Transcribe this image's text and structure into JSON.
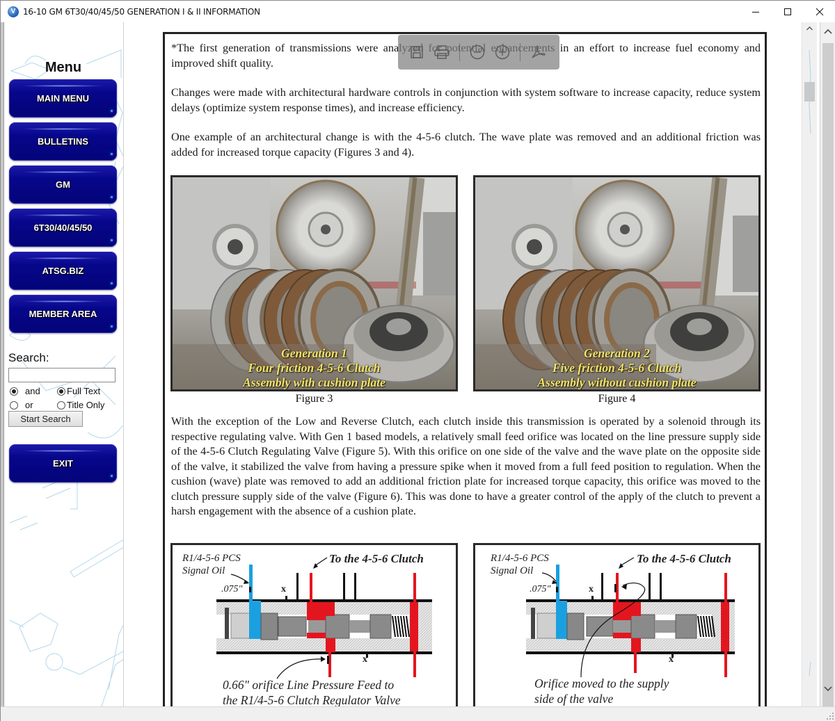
{
  "window": {
    "title": "16-10 GM 6T30/40/45/50 GENERATION I & II INFORMATION",
    "app_icon_letter": "V",
    "controls": [
      "minimize",
      "maximize",
      "close"
    ]
  },
  "sidebar": {
    "menu_title": "Menu",
    "nav_buttons": [
      {
        "label": "MAIN MENU"
      },
      {
        "label": "BULLETINS"
      },
      {
        "label": "GM"
      },
      {
        "label": "6T30/40/45/50"
      },
      {
        "label": "ATSG.BIZ"
      },
      {
        "label": "MEMBER AREA"
      }
    ],
    "search": {
      "label": "Search:",
      "value": "",
      "placeholder": "",
      "options_logic": [
        {
          "label": "and",
          "selected": true
        },
        {
          "label": "or",
          "selected": false
        }
      ],
      "options_scope": [
        {
          "label": "Full Text",
          "selected": true
        },
        {
          "label": "Title Only",
          "selected": false
        }
      ],
      "button_label": "Start Search"
    },
    "exit_label": "EXIT"
  },
  "pdf_toolbar": {
    "icons": [
      "save-icon",
      "print-icon",
      "zoom-out-icon",
      "zoom-in-icon",
      "acrobat-icon"
    ]
  },
  "document": {
    "paragraphs": [
      "*The first generation of transmissions were analyzed for potential enhancements in an effort to increase fuel economy and improved shift quality.",
      "Changes were made with architectural hardware controls in conjunction with system software to increase capacity, reduce system delays (optimize system response times), and increase efficiency.",
      "One example of an architectural change is with the 4-5-6 clutch. The wave plate was removed and an additional friction was added for increased torque capacity (Figures 3 and 4).",
      "With the exception of the Low and Reverse Clutch, each clutch inside this transmission is operated by a solenoid through its respective regulating valve. With Gen 1 based models, a relatively small feed orifice was located on the line pressure supply side of the 4-5-6 Clutch Regulating Valve (Figure 5). With this orifice on one side of the valve and the wave plate on the opposite side of the valve, it stabilized the valve from having a pressure spike when it moved from a full feed position to regulation. When the cushion (wave) plate was removed to add an additional friction plate for increased torque capacity, this orifice was moved to the clutch pressure supply side of the valve (Figure 6). This was done to have a greater control of the apply of the clutch to prevent a harsh engagement with the absence of a cushion plate."
    ],
    "figures": [
      {
        "label": "Figure 3",
        "caption": [
          "Generation 1",
          "Four friction 4-5-6 Clutch",
          "Assembly with cushion plate"
        ],
        "friction_plates": 4
      },
      {
        "label": "Figure 4",
        "caption": [
          "Generation 2",
          "Five friction 4-5-6 Clutch",
          "Assembly without cushion plate"
        ],
        "friction_plates": 5
      }
    ],
    "diagrams": [
      {
        "signal_label": [
          "R1/4-5-6 PCS",
          "Signal Oil"
        ],
        "clutch_label": "To the 4-5-6 Clutch",
        "orifice_size": ".075\"",
        "exhaust_mark": "x",
        "note": [
          "0.66\" orifice Line Pressure Feed to",
          "the R1/4-5-6 Clutch Regulator Valve"
        ]
      },
      {
        "signal_label": [
          "R1/4-5-6 PCS",
          "Signal Oil"
        ],
        "clutch_label": "To the 4-5-6 Clutch",
        "orifice_size": ".075\"",
        "exhaust_mark": "x",
        "note": [
          "Orifice moved to the supply",
          "side of the valve"
        ]
      }
    ],
    "colors": {
      "pressure_red": "#e3161f",
      "signal_blue": "#1aa0e0",
      "caption_yellow": "#f1e36a",
      "nav_button_blue": "#06068c"
    }
  }
}
